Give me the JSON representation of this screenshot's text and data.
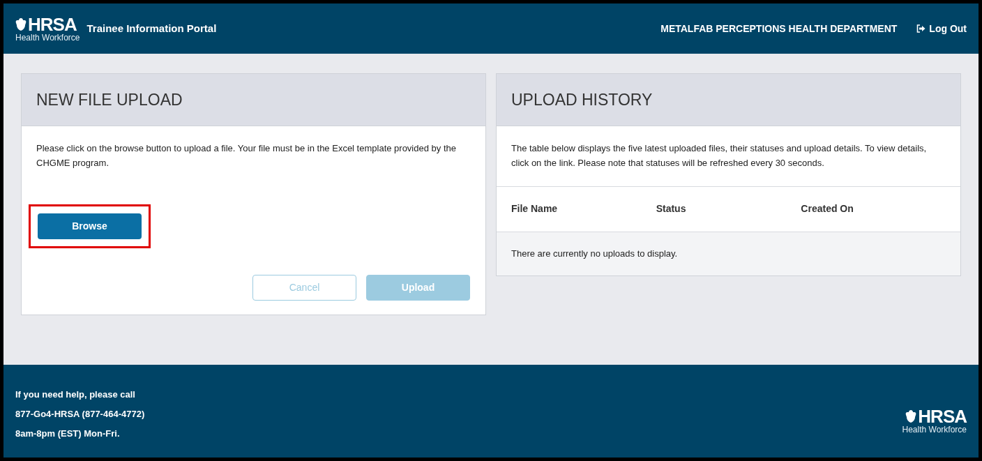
{
  "header": {
    "logo": {
      "wordmark": "HRSA",
      "subtitle": "Health Workforce"
    },
    "portal_title": "Trainee Information Portal",
    "organization": "METALFAB PERCEPTIONS HEALTH DEPARTMENT",
    "logout": "Log Out"
  },
  "upload_panel": {
    "title": "NEW FILE UPLOAD",
    "instructions": "Please click on the browse button to upload a file. Your file must be in the Excel template provided by the CHGME program.",
    "browse_button": {
      "label": "Browse",
      "highlighted": true
    },
    "actions": [
      {
        "kind": "outline",
        "label": "Cancel",
        "disabled": true
      },
      {
        "kind": "solid",
        "label": "Upload",
        "disabled": true
      }
    ]
  },
  "history_panel": {
    "title": "UPLOAD HISTORY",
    "description": "The table below displays the five latest uploaded files, their statuses and upload details. To view details, click on the link. Please note that statuses will be refreshed every 30 seconds.",
    "columns": [
      "File Name",
      "Status",
      "Created On"
    ],
    "empty_message": "There are currently no uploads to display."
  },
  "footer": {
    "help_lines": [
      "If you need help, please call",
      "877-Go4-HRSA (877-464-4772)",
      "8am-8pm (EST) Mon-Fri."
    ],
    "logo": {
      "wordmark": "HRSA",
      "subtitle": "Health Workforce"
    }
  }
}
